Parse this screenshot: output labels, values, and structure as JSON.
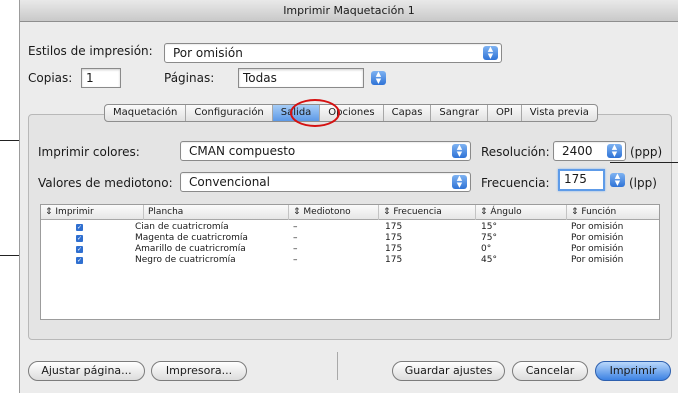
{
  "window": {
    "title": "Imprimir Maquetación 1"
  },
  "styles": {
    "label": "Estilos de impresión:",
    "value": "Por omisión"
  },
  "copies": {
    "label": "Copias:",
    "value": "1"
  },
  "pages": {
    "label": "Páginas:",
    "value": "Todas"
  },
  "tabs": [
    {
      "label": "Maquetación"
    },
    {
      "label": "Configuración"
    },
    {
      "label": "Salida",
      "active": true
    },
    {
      "label": "Opciones"
    },
    {
      "label": "Capas"
    },
    {
      "label": "Sangrar"
    },
    {
      "label": "OPI"
    },
    {
      "label": "Vista previa"
    }
  ],
  "output": {
    "print_colors_label": "Imprimir colores:",
    "print_colors_value": "CMAN compuesto",
    "resolution_label": "Resolución:",
    "resolution_value": "2400",
    "resolution_unit": "(ppp)",
    "halftone_label": "Valores de mediotono:",
    "halftone_value": "Convencional",
    "frequency_label": "Frecuencia:",
    "frequency_value": "175",
    "frequency_unit": "(lpp)"
  },
  "table": {
    "headers": [
      "Imprimir",
      "Plancha",
      "Mediotono",
      "Frecuencia",
      "Ángulo",
      "Función"
    ],
    "rows": [
      {
        "plate": "Cian de cuatricromía",
        "halftone": "–",
        "frequency": "175",
        "angle": "15°",
        "function": "Por omisión"
      },
      {
        "plate": "Magenta de cuatricromía",
        "halftone": "–",
        "frequency": "175",
        "angle": "75°",
        "function": "Por omisión"
      },
      {
        "plate": "Amarillo de cuatricromía",
        "halftone": "–",
        "frequency": "175",
        "angle": "0°",
        "function": "Por omisión"
      },
      {
        "plate": "Negro de cuatricromía",
        "halftone": "–",
        "frequency": "175",
        "angle": "45°",
        "function": "Por omisión"
      }
    ]
  },
  "buttons": {
    "adjust_page": "Ajustar página...",
    "printer": "Impresora...",
    "save_settings": "Guardar ajustes",
    "cancel": "Cancelar",
    "print": "Imprimir"
  },
  "colors": {
    "accent": "#3c82e3",
    "highlight_ring": "#d51111"
  }
}
